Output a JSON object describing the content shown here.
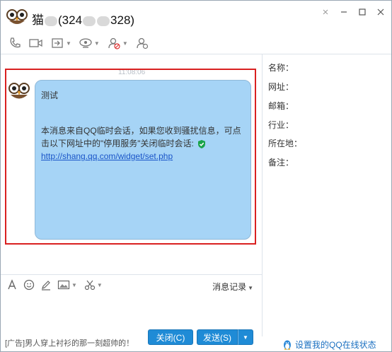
{
  "window": {
    "title_name": "猫",
    "title_id_start": "(324",
    "title_id_end": "328)",
    "controls": [
      "pin",
      "minimize",
      "maximize",
      "close"
    ]
  },
  "toolbar": {
    "icons": [
      "phone-icon",
      "video-icon",
      "transfer-file-icon",
      "remote-assist-icon",
      "block-user-icon",
      "add-friend-icon"
    ]
  },
  "chat": {
    "timestamp": "11:08:06",
    "message": {
      "line1": "测试",
      "line2": "本消息来自QQ临时会话，如果您收到骚扰信息，可点",
      "line3": "击以下网址中的\"停用服务\"关闭临时会话:",
      "link": "http://shang.qq.com/widget/set.php"
    }
  },
  "side": {
    "name_label": "名称：",
    "url_label": "网址：",
    "email_label": "邮箱：",
    "industry_label": "行业：",
    "location_label": "所在地：",
    "note_label": "备注："
  },
  "input_toolbar": {
    "history_label": "消息记录"
  },
  "bottom": {
    "ad_text": "[广告]男人穿上衬衫的那一刻超帅的！",
    "close_label": "关闭(C)",
    "send_label": "发送(S)",
    "status_link": "设置我的QQ在线状态"
  },
  "colors": {
    "bubble": "#a6d4f6",
    "button": "#1f8bd6",
    "highlight": "#d92020",
    "link": "#1a55c8"
  }
}
